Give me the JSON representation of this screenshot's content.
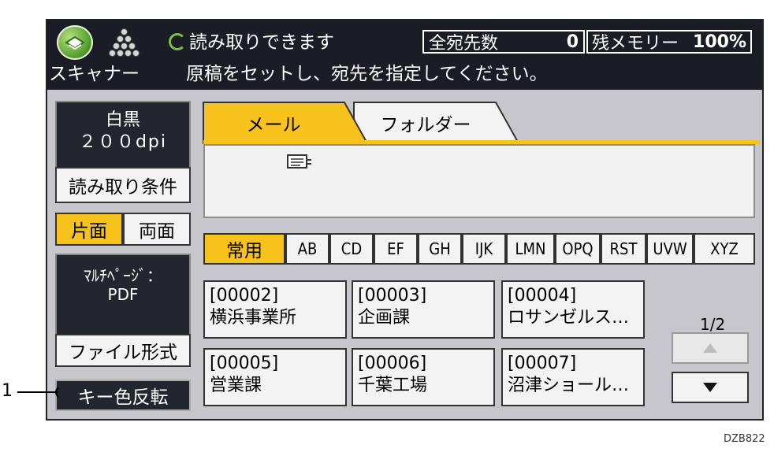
{
  "header": {
    "app_name": "スキャナー",
    "status": "読み取りできます",
    "message": "原稿をセットし、宛先を指定してください。",
    "dest_count_label": "全宛先数",
    "dest_count_value": "0",
    "memory_label": "残メモリー",
    "memory_value": "100%"
  },
  "left": {
    "color_mode": "白黒",
    "resolution": "２００dpi",
    "scan_settings_button": "読み取り条件",
    "simplex_button": "片面",
    "duplex_button": "両面",
    "file_type_line1": "ﾏﾙﾁﾍﾟｰｼﾞ：",
    "file_type_line2": "PDF",
    "file_format_button": "ファイル形式",
    "invert_keys_button": "キー色反転"
  },
  "tabs": {
    "mail": "メール",
    "folder": "フォルダー"
  },
  "index_tabs": [
    "常用",
    "AB",
    "CD",
    "EF",
    "GH",
    "IJK",
    "LMN",
    "OPQ",
    "RST",
    "UVW",
    "XYZ"
  ],
  "destinations": [
    {
      "id": "[00002]",
      "name": "横浜事業所"
    },
    {
      "id": "[00003]",
      "name": "企画課"
    },
    {
      "id": "[00004]",
      "name": "ロサンゼルス…"
    },
    {
      "id": "[00005]",
      "name": "営業課"
    },
    {
      "id": "[00006]",
      "name": "千葉工場"
    },
    {
      "id": "[00007]",
      "name": "沼津ショール…"
    }
  ],
  "pagination": {
    "page": "1/2"
  },
  "callout": "1",
  "figure_code": "DZB822",
  "colors": {
    "accent": "#f6c21b",
    "header_bg": "#1b1d26",
    "panel_bg": "#c6c6cc"
  }
}
